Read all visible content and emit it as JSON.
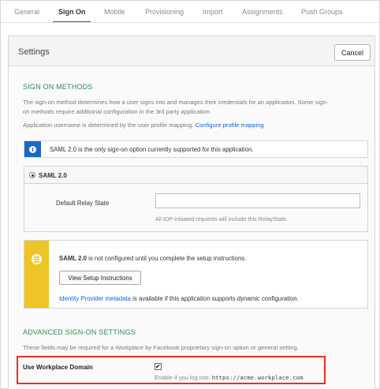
{
  "tabs": [
    {
      "label": "General"
    },
    {
      "label": "Sign On"
    },
    {
      "label": "Mobile"
    },
    {
      "label": "Provisioning"
    },
    {
      "label": "Import"
    },
    {
      "label": "Assignments"
    },
    {
      "label": "Push Groups"
    }
  ],
  "active_tab": "Sign On",
  "accent_color": "#1662dd",
  "settings": {
    "title": "Settings",
    "cancel_label": "Cancel"
  },
  "sign_on_methods": {
    "title": "SIGN ON METHODS",
    "description_line1": "The sign-on method determines how a user signs into and manages their credentials for an application. Some sign-",
    "description_line2": "on methods require additional configuration in the 3rd party application.",
    "username_text": "Application username is determined by the user profile mapping.",
    "profile_mapping_link": "Configure profile mapping",
    "info_text": "SAML 2.0 is the only sign-on option currently supported for this application.",
    "saml_option": "SAML 2.0",
    "relay_state_label": "Default Relay State",
    "relay_state_value": "",
    "relay_state_hint": "All IDP-initiated requests will include this RelayState.",
    "warning_bold": "SAML 2.0",
    "warning_text": " is not configured until you complete the setup instructions.",
    "setup_button": "View Setup Instructions",
    "metadata_link": "Identity Provider metadata",
    "metadata_text": " is available if this application supports dynamic configuration."
  },
  "advanced": {
    "title": "ADVANCED SIGN-ON SETTINGS",
    "description": "These fields may be required for a Workplace by Facebook proprietary sign-on option or general setting.",
    "workplace_domain_label": "Use Workplace Domain",
    "workplace_domain_checked": true,
    "checkbox_glyph": "✔",
    "hint_prefix": "Enable if you log into: ",
    "hint_domain": "https://acme.workplace.com"
  },
  "colors": {
    "info_blue": "#1d68c2",
    "warning_yellow": "#edc526",
    "highlight_red": "#e53124",
    "section_green": "#2e8b57"
  },
  "icons": {
    "info": "info-circle-icon",
    "warning": "list-circle-icon",
    "radio": "radio-selected-icon"
  }
}
